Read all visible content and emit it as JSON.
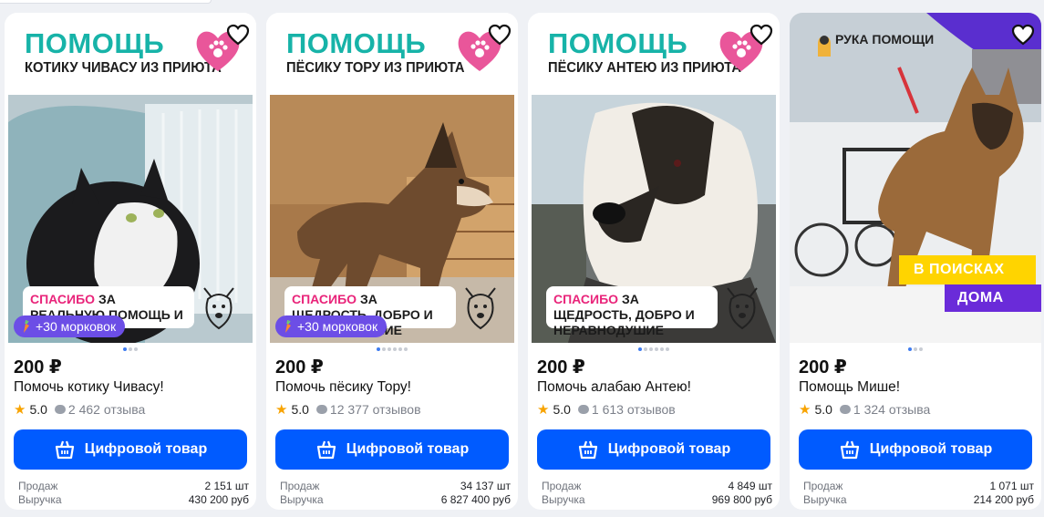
{
  "products": [
    {
      "banner_title": "ПОМОЩЬ",
      "banner_subtitle": "КОТИКУ ЧИВАСУ ИЗ ПРИЮТА",
      "thanks_pink": "СПАСИБО",
      "thanks_rest": " ЗА РЕАЛЬНУЮ ПОМОЩЬ И ЗАБОТУ",
      "promo": "+30 морковок",
      "price": "200 ₽",
      "title": "Помочь котику Чивасу!",
      "rating": "5.0",
      "reviews": "2 462 отзыва",
      "button": "Цифровой товар",
      "sold_label": "Продаж",
      "sold": "2 151 шт",
      "revenue_label": "Выручка",
      "revenue": "430 200 руб"
    },
    {
      "banner_title": "ПОМОЩЬ",
      "banner_subtitle": "ПЁСИКУ ТОРУ ИЗ ПРИЮТА",
      "thanks_pink": "СПАСИБО",
      "thanks_rest": " ЗА ЩЕДРОСТЬ, ДОБРО И НЕРАВНОДУШИЕ",
      "promo": "+30 морковок",
      "price": "200 ₽",
      "title": "Помочь пёсику Тору!",
      "rating": "5.0",
      "reviews": "12 377 отзывов",
      "button": "Цифровой товар",
      "sold_label": "Продаж",
      "sold": "34 137 шт",
      "revenue_label": "Выручка",
      "revenue": "6 827 400 руб"
    },
    {
      "banner_title": "ПОМОЩЬ",
      "banner_subtitle": "ПЁСИКУ АНТЕЮ ИЗ ПРИЮТА",
      "thanks_pink": "СПАСИБО",
      "thanks_rest": " ЗА ЩЕДРОСТЬ, ДОБРО И НЕРАВНОДУШИЕ",
      "price": "200 ₽",
      "title": "Помочь алабаю Антею!",
      "rating": "5.0",
      "reviews": "1 613 отзывов",
      "button": "Цифровой товар",
      "sold_label": "Продаж",
      "sold": "4 849 шт",
      "revenue_label": "Выручка",
      "revenue": "969 800 руб"
    },
    {
      "logo": "РУКА ПОМОЩИ",
      "tag_yellow": "В ПОИСКАХ",
      "tag_purple": "ДОМА",
      "price": "200 ₽",
      "title": "Помощь Мише!",
      "rating": "5.0",
      "reviews": "1 324 отзыва",
      "button": "Цифровой товар",
      "sold_label": "Продаж",
      "sold": "1 071 шт",
      "revenue_label": "Выручка",
      "revenue": "214 200 руб"
    }
  ],
  "icons": {
    "favorite": "heart-outline-icon",
    "basket": "basket-icon",
    "star": "star-icon",
    "reviews": "speech-bubble-icon"
  },
  "colors": {
    "button": "#005bff",
    "promo": "#6c4ee6",
    "banner_title": "#17b3a8",
    "thanks_accent": "#e9247a",
    "star": "#f8a300"
  }
}
